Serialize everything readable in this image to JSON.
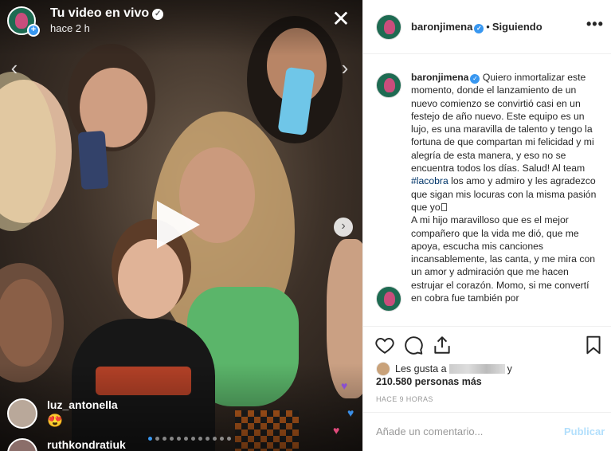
{
  "live": {
    "title": "Tu video en vivo",
    "time": "hace 2 h",
    "comments": [
      {
        "user": "luz_antonella",
        "text": "😍"
      },
      {
        "user": "ruthkondratiuk",
        "text": ""
      }
    ]
  },
  "post": {
    "username": "baronjimena",
    "separator": "•",
    "follow_status": "Siguiendo",
    "more": "•••",
    "caption": {
      "p1": "Quiero inmortalizar este momento, donde el lanzamiento de un nuevo comienzo se convirtió casi en un festejo de año nuevo. Este equipo es un lujo, es una maravilla de talento y tengo la fortuna de que compartan mi felicidad y mi alegría de esta manera, y eso no se encuentra todos los días. Salud! Al team",
      "hashtag": "#lacobra",
      "p1_end": "los amo y admiro y les agradezco que sigan mis locuras con la misma pasión que yo",
      "p2": "A mi hijo maravilloso que es el mejor compañero que la vida me dió, que me apoya, escucha mis canciones incansablemente, las canta, y me mira con un amor y admiración que me hacen estrujar el corazón. Momo, si me convertí en cobra fue también por"
    },
    "likes_prefix": "Les gusta a",
    "likes_and": "y",
    "likes_count": "210.580 personas más",
    "time": "HACE 9 HORAS",
    "comment_placeholder": "Añade un comentario...",
    "publish": "Publicar"
  },
  "icons": {
    "live_close": "close-icon",
    "like": "heart-outline-icon",
    "comment": "comment-bubble-icon",
    "share": "share-icon",
    "save": "bookmark-icon",
    "verified": "verified-check-icon"
  },
  "colors": {
    "accent": "#3897f0",
    "link": "#003569",
    "publish_disabled": "#b2dffc"
  }
}
